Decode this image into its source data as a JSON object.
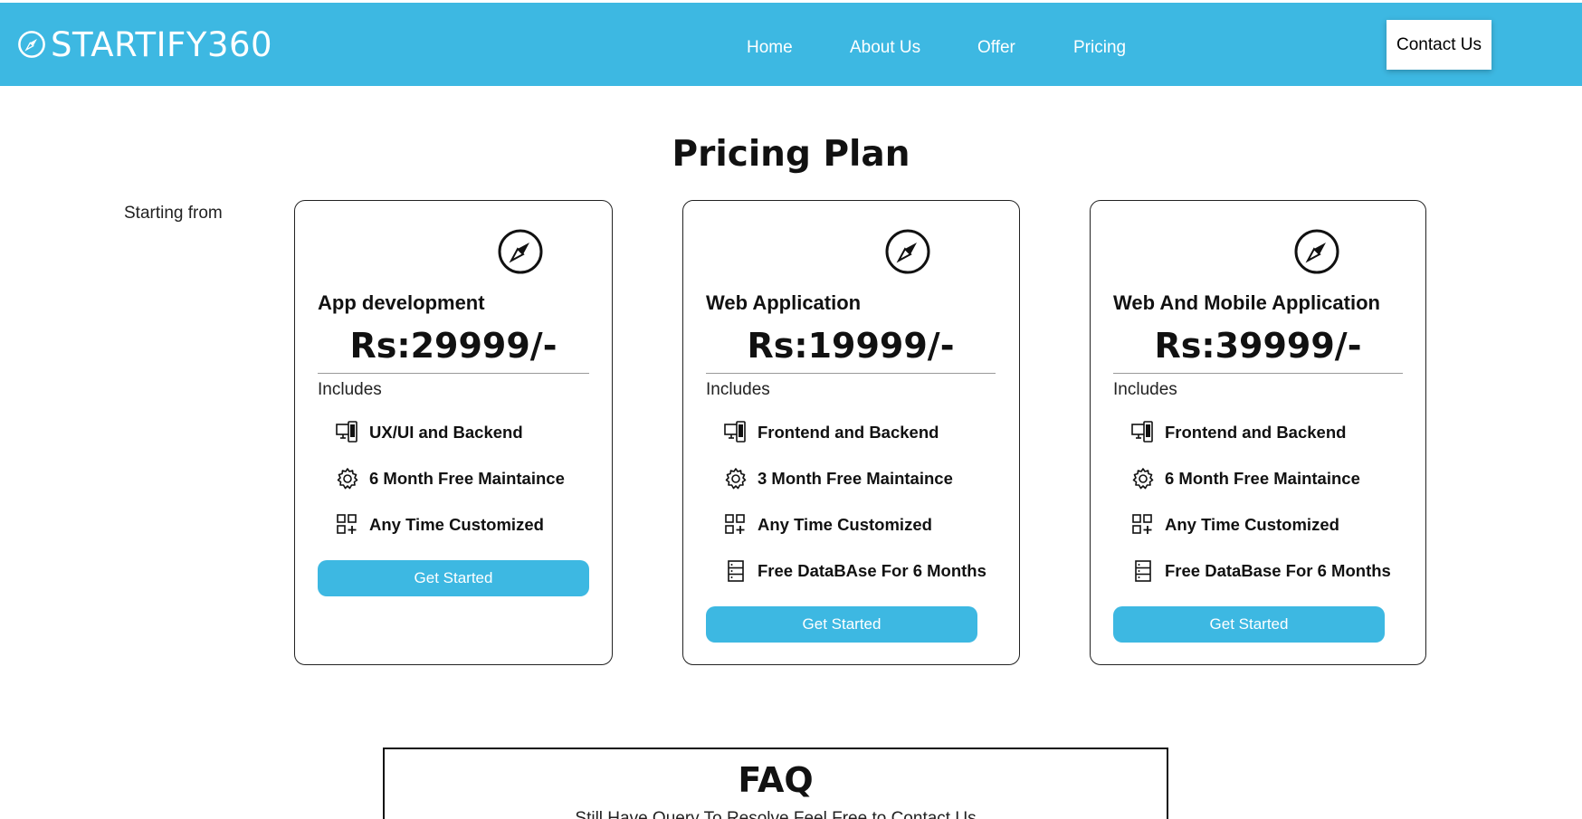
{
  "header": {
    "brand": "STARTIFY360",
    "nav": [
      "Home",
      "About Us",
      "Offer",
      "Pricing"
    ],
    "contact_label": "Contact Us",
    "background_color": "#3db8e2"
  },
  "pricing": {
    "title": "Pricing Plan",
    "starting_from": "Starting from",
    "includes_label": "Includes",
    "plans": [
      {
        "name": "App development",
        "price": "Rs:29999/-",
        "features": [
          {
            "icon": "devices-icon",
            "text": "UX/UI and Backend"
          },
          {
            "icon": "gear-icon",
            "text": "6 Month Free Maintaince"
          },
          {
            "icon": "apps-add-icon",
            "text": "Any Time Customized"
          }
        ],
        "cta": "Get Started"
      },
      {
        "name": "Web Application",
        "price": "Rs:19999/-",
        "features": [
          {
            "icon": "devices-icon",
            "text": "Frontend and Backend"
          },
          {
            "icon": "gear-icon",
            "text": "3 Month Free Maintaince"
          },
          {
            "icon": "apps-add-icon",
            "text": "Any Time Customized"
          },
          {
            "icon": "database-icon",
            "text": "Free DataBAse For 6 Months"
          }
        ],
        "cta": "Get Started"
      },
      {
        "name": "Web And Mobile Application",
        "price": "Rs:39999/-",
        "features": [
          {
            "icon": "devices-icon",
            "text": "Frontend and Backend"
          },
          {
            "icon": "gear-icon",
            "text": "6 Month Free Maintaince"
          },
          {
            "icon": "apps-add-icon",
            "text": "Any Time Customized"
          },
          {
            "icon": "database-icon",
            "text": "Free DataBase For 6 Months"
          }
        ],
        "cta": "Get Started"
      }
    ]
  },
  "faq": {
    "title": "FAQ",
    "subtitle": "Still Have Query To Resolve Feel Free to Contact Us"
  }
}
